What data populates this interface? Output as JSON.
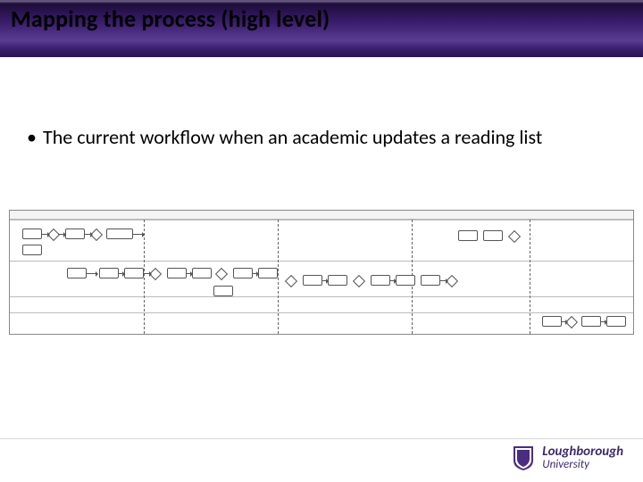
{
  "title": "Mapping the process (high level)",
  "bullet": "The current workflow when an academic updates a reading list",
  "logo": {
    "line1": "Loughborough",
    "line2": "University"
  }
}
